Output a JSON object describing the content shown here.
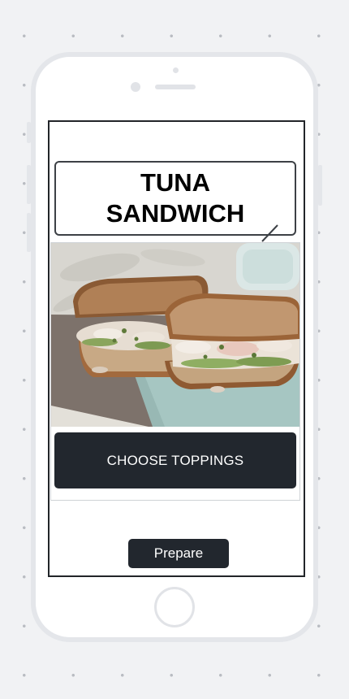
{
  "title": {
    "line1": "TUNA",
    "line2": "SANDWICH"
  },
  "image": {
    "icon": "tuna-sandwich-photo"
  },
  "buttons": {
    "choose_toppings": "CHOOSE TOPPINGS",
    "prepare": "Prepare"
  },
  "colors": {
    "button_bg": "#22272e",
    "button_text": "#ffffff",
    "page_bg": "#f1f2f4"
  }
}
